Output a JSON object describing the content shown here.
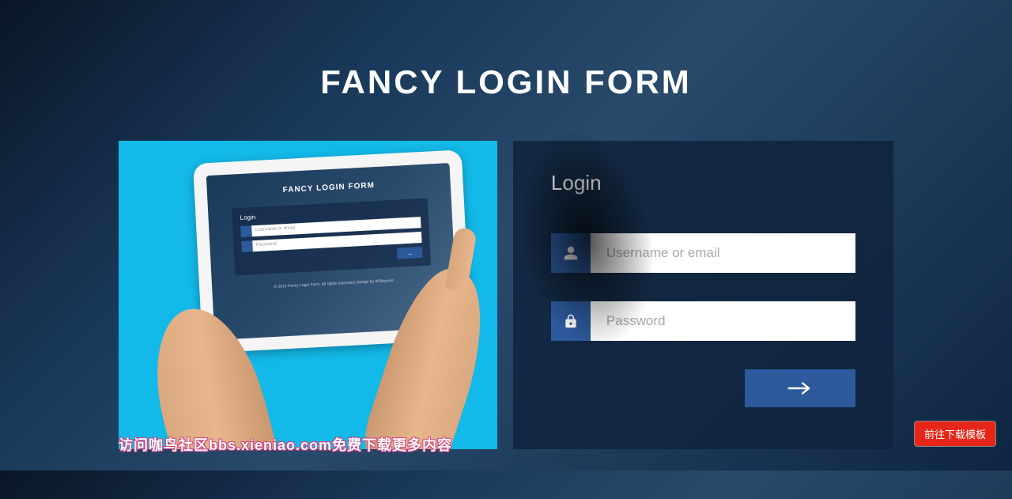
{
  "page": {
    "title": "FANCY LOGIN FORM"
  },
  "preview": {
    "title": "FANCY LOGIN FORM",
    "login_label": "Login",
    "username_placeholder": "Username or email",
    "password_placeholder": "Password",
    "footer": "© 2016 Fancy Login Form. All rights reserved | Design by W3layouts"
  },
  "login": {
    "heading": "Login",
    "username_placeholder": "Username or email",
    "password_placeholder": "Password"
  },
  "download_button": "前往下载模板",
  "watermark": "访问咖鸟社区bbs.xieniao.com免费下载更多内容"
}
